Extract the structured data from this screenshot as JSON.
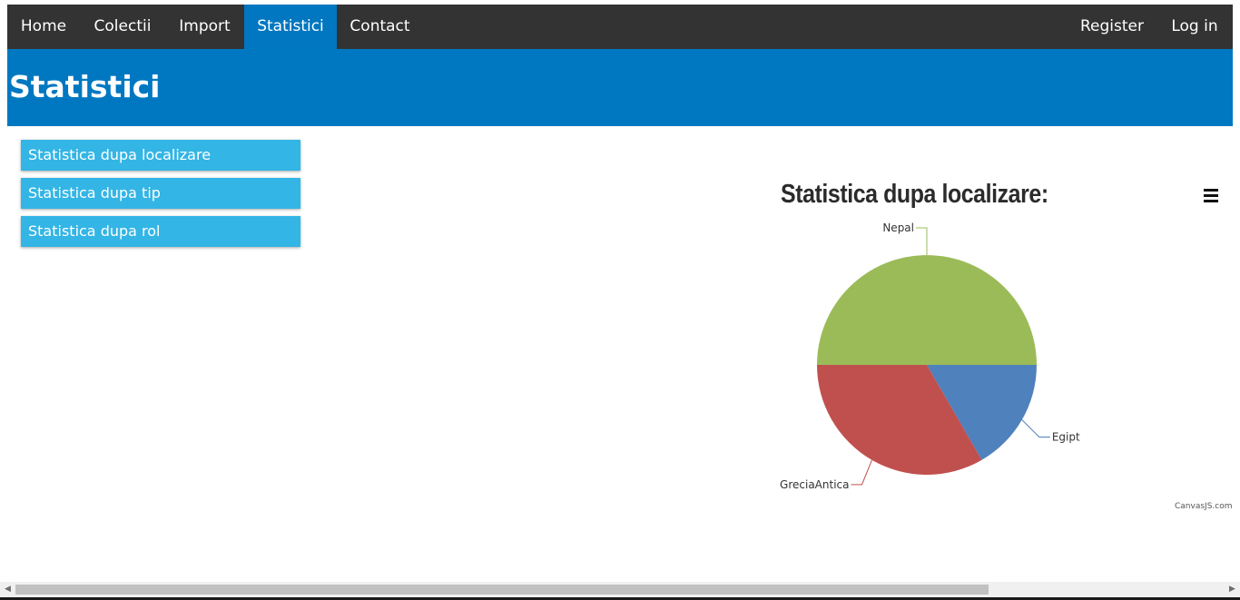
{
  "nav": {
    "items": [
      {
        "label": "Home"
      },
      {
        "label": "Colectii"
      },
      {
        "label": "Import"
      },
      {
        "label": "Statistici",
        "active": true
      },
      {
        "label": "Contact"
      }
    ],
    "right_items": [
      {
        "label": "Register"
      },
      {
        "label": "Log in"
      }
    ]
  },
  "header": {
    "title": "Statistici"
  },
  "sidebar": {
    "items": [
      {
        "label": "Statistica dupa localizare"
      },
      {
        "label": "Statistica dupa tip"
      },
      {
        "label": "Statistica dupa rol"
      }
    ]
  },
  "chart": {
    "menu_icon": "hamburger-icon",
    "credit": "CanvasJS.com"
  },
  "chart_data": {
    "type": "pie",
    "title": "Statistica dupa localizare:",
    "slices": [
      {
        "label": "Egipt",
        "value": 1,
        "color": "#4f81bc"
      },
      {
        "label": "GreciaAntica",
        "value": 2,
        "color": "#c0504e"
      },
      {
        "label": "Nepal",
        "value": 3,
        "color": "#9bbb58"
      }
    ],
    "start_angle_deg": 0,
    "legend": "none"
  },
  "colors": {
    "navbar": "#333333",
    "accent": "#0078c1",
    "sidebar_button": "#33b5e5"
  },
  "scrollbar": {
    "left_arrow": "◀",
    "right_arrow": "▶"
  }
}
